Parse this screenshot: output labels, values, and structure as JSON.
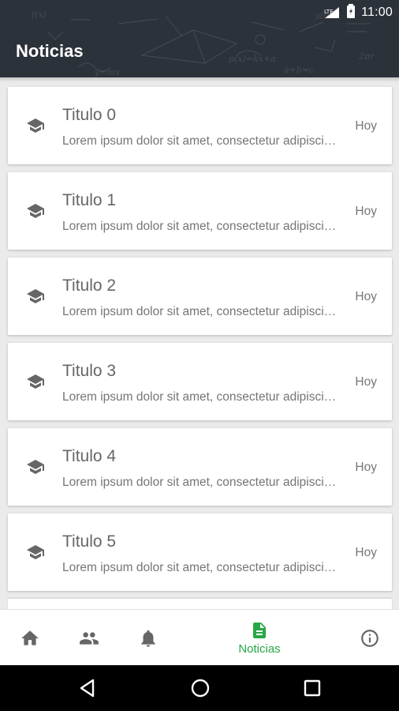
{
  "status_bar": {
    "network": "LTE",
    "time": "11:00"
  },
  "app_bar": {
    "title": "Noticias"
  },
  "news": [
    {
      "title": "Titulo 0",
      "body": "Lorem ipsum dolor sit amet, consectetur adipiscing elit",
      "date": "Hoy",
      "icon": "graduation-cap-icon"
    },
    {
      "title": "Titulo 1",
      "body": "Lorem ipsum dolor sit amet, consectetur adipiscing elit",
      "date": "Hoy",
      "icon": "graduation-cap-icon"
    },
    {
      "title": "Titulo 2",
      "body": "Lorem ipsum dolor sit amet, consectetur adipiscing elit",
      "date": "Hoy",
      "icon": "graduation-cap-icon"
    },
    {
      "title": "Titulo 3",
      "body": "Lorem ipsum dolor sit amet, consectetur adipiscing elit",
      "date": "Hoy",
      "icon": "graduation-cap-icon"
    },
    {
      "title": "Titulo 4",
      "body": "Lorem ipsum dolor sit amet, consectetur adipiscing elit",
      "date": "Hoy",
      "icon": "graduation-cap-icon"
    },
    {
      "title": "Titulo 5",
      "body": "Lorem ipsum dolor sit amet, consectetur adipiscing elit",
      "date": "Hoy",
      "icon": "graduation-cap-icon"
    }
  ],
  "bottom_nav": {
    "items": [
      {
        "icon": "home-icon",
        "label": ""
      },
      {
        "icon": "people-icon",
        "label": ""
      },
      {
        "icon": "bell-icon",
        "label": ""
      },
      {
        "icon": "document-icon",
        "label": "Noticias",
        "active": true
      },
      {
        "icon": "info-icon",
        "label": ""
      }
    ],
    "active_color": "#28a745",
    "inactive_color": "#666666"
  },
  "system_nav": {
    "buttons": [
      "back-icon",
      "home-circle-icon",
      "recents-icon"
    ]
  },
  "colors": {
    "header_bg": "#2b323a",
    "page_bg": "#ebebeb",
    "card_bg": "#ffffff"
  }
}
